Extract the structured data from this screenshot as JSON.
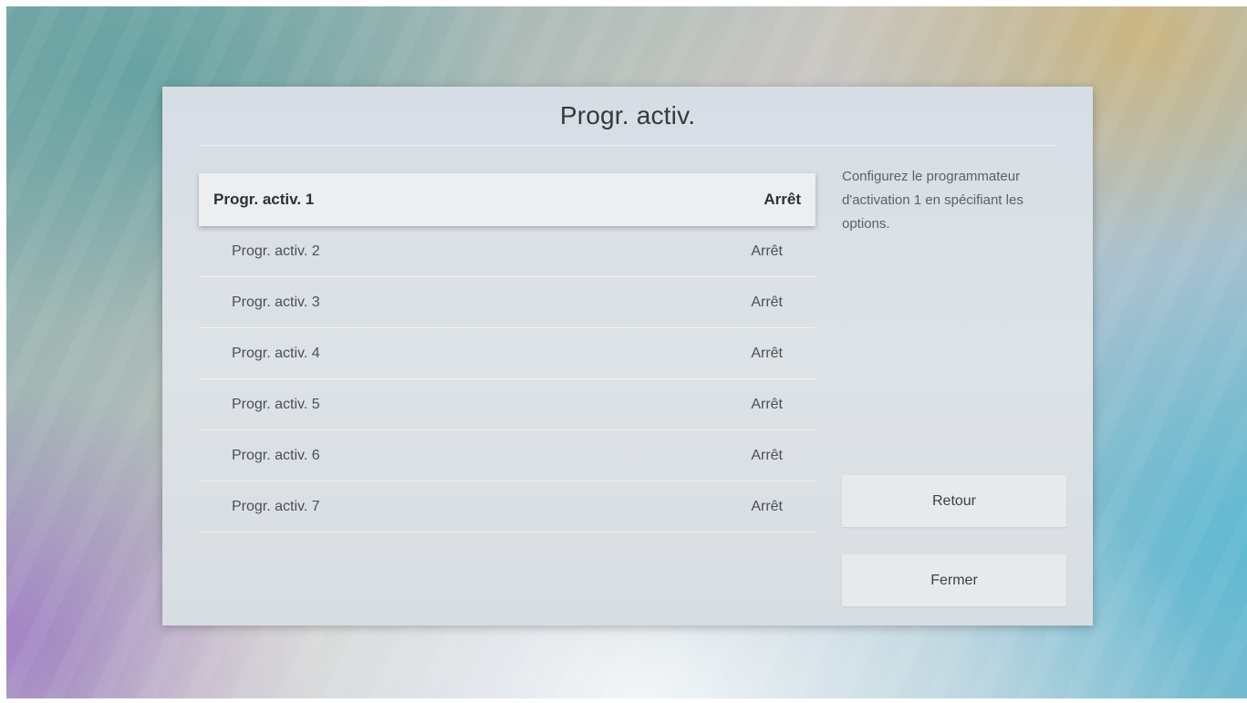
{
  "dialog": {
    "title": "Progr. activ.",
    "items": [
      {
        "label": "Progr. activ. 1",
        "value": "Arrêt"
      },
      {
        "label": "Progr. activ. 2",
        "value": "Arrêt"
      },
      {
        "label": "Progr. activ. 3",
        "value": "Arrêt"
      },
      {
        "label": "Progr. activ. 4",
        "value": "Arrêt"
      },
      {
        "label": "Progr. activ. 5",
        "value": "Arrêt"
      },
      {
        "label": "Progr. activ. 6",
        "value": "Arrêt"
      },
      {
        "label": "Progr. activ. 7",
        "value": "Arrêt"
      }
    ],
    "description": "Configurez le programmateur d'activation 1 en spécifiant les options.",
    "back_label": "Retour",
    "close_label": "Fermer"
  },
  "colors": {
    "selected_row": "#eceeef",
    "dialog_bg": "#dde2e6"
  }
}
